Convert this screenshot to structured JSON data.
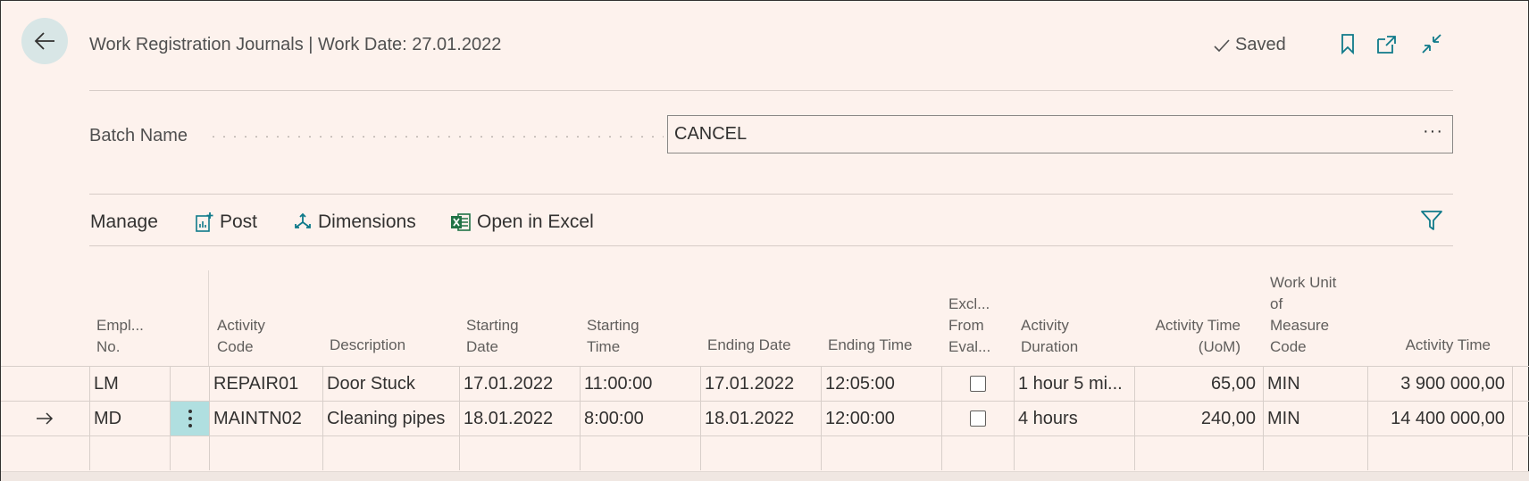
{
  "header": {
    "title": "Work Registration Journals | Work Date: 27.01.2022",
    "saved_label": "Saved"
  },
  "batch": {
    "label": "Batch Name",
    "value": "CANCEL",
    "lookup": "···"
  },
  "actions": {
    "manage": "Manage",
    "post": "Post",
    "dimensions": "Dimensions",
    "open_excel": "Open in Excel"
  },
  "columns": {
    "employee_no": [
      "Empl...",
      "No."
    ],
    "activity_code": [
      "Activity",
      "Code"
    ],
    "description": "Description",
    "starting_date": [
      "Starting",
      "Date"
    ],
    "starting_time": [
      "Starting",
      "Time"
    ],
    "ending_date": "Ending Date",
    "ending_time": "Ending Time",
    "excl_from_eval": [
      "Excl...",
      "From",
      "Eval..."
    ],
    "activity_duration": [
      "Activity",
      "Duration"
    ],
    "activity_time_uom": [
      "Activity Time",
      "(UoM)"
    ],
    "work_unit_code": [
      "Work Unit",
      "of",
      "Measure",
      "Code"
    ],
    "activity_time": "Activity Time"
  },
  "rows": [
    {
      "employee_no": "LM",
      "activity_code": "REPAIR01",
      "description": "Door Stuck",
      "starting_date": "17.01.2022",
      "starting_time": "11:00:00",
      "ending_date": "17.01.2022",
      "ending_time": "12:05:00",
      "activity_duration": "1 hour 5 mi...",
      "activity_time_uom": "65,00",
      "work_unit_code": "MIN",
      "activity_time": "3 900 000,00"
    },
    {
      "employee_no": "MD",
      "activity_code": "MAINTN02",
      "description": "Cleaning pipes",
      "starting_date": "18.01.2022",
      "starting_time": "8:00:00",
      "ending_date": "18.01.2022",
      "ending_time": "12:00:00",
      "activity_duration": "4 hours",
      "activity_time_uom": "240,00",
      "work_unit_code": "MIN",
      "activity_time": "14 400 000,00"
    }
  ],
  "colors": {
    "background": "#fdf2ed",
    "accent": "#0f7a8a",
    "selected_cell": "#b0dfe0",
    "excel_green": "#217346"
  }
}
